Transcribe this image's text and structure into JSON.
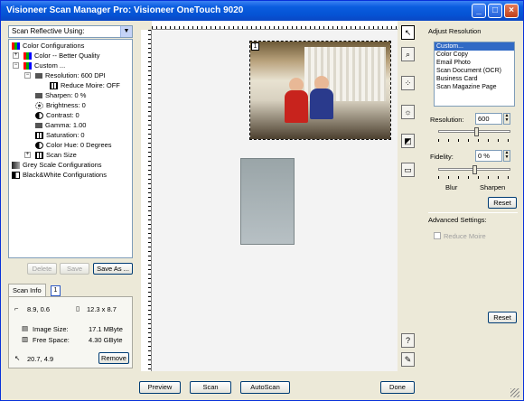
{
  "window": {
    "title": "Visioneer Scan Manager Pro:  Visioneer OneTouch 9020",
    "minimize": "_",
    "maximize": "□",
    "close": "×"
  },
  "scan_mode": {
    "value": "Scan Reflective Using:"
  },
  "tree": {
    "color_configs": "Color Configurations",
    "color_better": "Color -- Better Quality",
    "custom": "Custom ...",
    "resolution": "Resolution: 600 DPI",
    "reduce_moire": "Reduce Moire: OFF",
    "sharpen": "Sharpen: 0 %",
    "brightness": "Brightness: 0",
    "contrast": "Contrast: 0",
    "gamma": "Gamma: 1.00",
    "saturation": "Saturation: 0",
    "color_hue": "Color Hue: 0 Degrees",
    "scan_size": "Scan Size",
    "grey_configs": "Grey Scale Configurations",
    "bw_configs": "Black&White Configurations"
  },
  "config_buttons": {
    "delete": "Delete",
    "save": "Save",
    "save_as": "Save As ..."
  },
  "scan_info": {
    "tab": "Scan Info",
    "tab_num": "1",
    "position": "8.9, 0.6",
    "size": "12.3 x 8.7",
    "image_size_label": "Image Size:",
    "image_size": "17.1 MByte",
    "free_space_label": "Free Space:",
    "free_space": "4.30 GByte",
    "cursor": "20.7, 4.9",
    "remove": "Remove"
  },
  "preview": {
    "selection_number": "1"
  },
  "right_panel": {
    "header": "Adjust Resolution",
    "presets": [
      "Custom...",
      "Color Copy",
      "Email Photo",
      "Scan Document (OCR)",
      "Business Card",
      "Scan Magazine Page"
    ],
    "resolution_label": "Resolution:",
    "resolution_value": "600",
    "fidelity_label": "Fidelity:",
    "fidelity_value": "0 %",
    "blur": "Blur",
    "sharpen": "Sharpen",
    "reset1": "Reset",
    "advanced": "Advanced Settings:",
    "reduce_moire": "Reduce Moire",
    "reset2": "Reset"
  },
  "bottom": {
    "preview": "Preview",
    "scan": "Scan",
    "autoscan": "AutoScan",
    "done": "Done"
  },
  "colors": {
    "titlebar": "#0a5ddf",
    "selection": "#316ac5",
    "face": "#ece9d8"
  }
}
